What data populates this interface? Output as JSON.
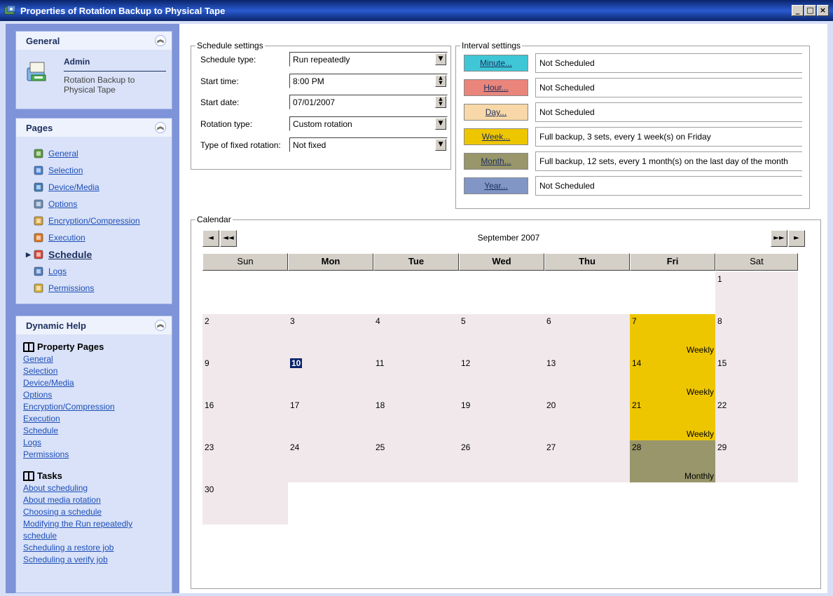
{
  "window": {
    "title": "Properties of Rotation Backup to Physical Tape",
    "min_label": "_",
    "max_label": "□",
    "close_label": "×"
  },
  "sidebar": {
    "general": {
      "title": "General",
      "user": "Admin",
      "description": "Rotation Backup to Physical Tape"
    },
    "pages": {
      "title": "Pages",
      "items": [
        {
          "label": "General",
          "icon": "document-icon"
        },
        {
          "label": "Selection",
          "icon": "folder-icon"
        },
        {
          "label": "Device/Media",
          "icon": "device-icon"
        },
        {
          "label": "Options",
          "icon": "options-icon"
        },
        {
          "label": "Encryption/Compression",
          "icon": "key-icon"
        },
        {
          "label": "Execution",
          "icon": "execution-icon"
        },
        {
          "label": "Schedule",
          "icon": "schedule-icon"
        },
        {
          "label": "Logs",
          "icon": "logs-icon"
        },
        {
          "label": "Permissions",
          "icon": "lock-icon"
        }
      ],
      "current": "Schedule"
    },
    "help": {
      "title": "Dynamic Help",
      "property_pages_title": "Property Pages",
      "property_pages": [
        "General",
        "Selection",
        "Device/Media",
        "Options",
        "Encryption/Compression",
        "Execution",
        "Schedule",
        "Logs",
        "Permissions"
      ],
      "tasks_title": "Tasks",
      "tasks": [
        "About scheduling",
        "About media rotation",
        "Choosing a schedule",
        "Modifying the Run repeatedly",
        "schedule",
        "Scheduling a restore job",
        "Scheduling a verify job"
      ]
    }
  },
  "schedule_settings": {
    "legend": "Schedule settings",
    "schedule_type": {
      "label": "Schedule type:",
      "value": "Run repeatedly"
    },
    "start_time": {
      "label": "Start time:",
      "value": "8:00 PM"
    },
    "start_date": {
      "label": "Start date:",
      "value": "07/01/2007"
    },
    "rotation_type": {
      "label": "Rotation type:",
      "value": "Custom rotation"
    },
    "fixed_rotation": {
      "label": "Type of fixed rotation:",
      "value": "Not fixed"
    }
  },
  "interval_settings": {
    "legend": "Interval settings",
    "rows": [
      {
        "button": "Minute...",
        "text": "Not Scheduled",
        "color": "#3fc7d6"
      },
      {
        "button": "Hour...",
        "text": "Not Scheduled",
        "color": "#e9857a"
      },
      {
        "button": "Day...",
        "text": "Not Scheduled",
        "color": "#f8d8a8"
      },
      {
        "button": "Week...",
        "text": "Full backup, 3 sets, every 1 week(s) on Friday",
        "color": "#eec600"
      },
      {
        "button": "Month...",
        "text": "Full backup, 12 sets, every 1 month(s) on the last day of the month",
        "color": "#98966a"
      },
      {
        "button": "Year...",
        "text": "Not Scheduled",
        "color": "#8296c6"
      }
    ]
  },
  "calendar": {
    "legend": "Calendar",
    "month_title": "September 2007",
    "nav_prev": "◄",
    "nav_prev_fast": "◄◄",
    "nav_next_fast": "►►",
    "nav_next": "►",
    "day_headers": [
      "Sun",
      "Mon",
      "Tue",
      "Wed",
      "Thu",
      "Fri",
      "Sat"
    ],
    "weeks": [
      [
        null,
        null,
        null,
        null,
        null,
        null,
        {
          "d": "1"
        }
      ],
      [
        {
          "d": "2"
        },
        {
          "d": "3"
        },
        {
          "d": "4"
        },
        {
          "d": "5"
        },
        {
          "d": "6"
        },
        {
          "d": "7",
          "label": "Weekly",
          "kind": "week"
        },
        {
          "d": "8"
        }
      ],
      [
        {
          "d": "9"
        },
        {
          "d": "10",
          "today": true
        },
        {
          "d": "11"
        },
        {
          "d": "12"
        },
        {
          "d": "13"
        },
        {
          "d": "14",
          "label": "Weekly",
          "kind": "week"
        },
        {
          "d": "15"
        }
      ],
      [
        {
          "d": "16"
        },
        {
          "d": "17"
        },
        {
          "d": "18"
        },
        {
          "d": "19"
        },
        {
          "d": "20"
        },
        {
          "d": "21",
          "label": "Weekly",
          "kind": "week"
        },
        {
          "d": "22"
        }
      ],
      [
        {
          "d": "23"
        },
        {
          "d": "24"
        },
        {
          "d": "25"
        },
        {
          "d": "26"
        },
        {
          "d": "27"
        },
        {
          "d": "28",
          "label": "Monthly",
          "kind": "month"
        },
        {
          "d": "29"
        }
      ],
      [
        {
          "d": "30"
        },
        null,
        null,
        null,
        null,
        null,
        null
      ]
    ],
    "colors": {
      "day_bg": "#f0e8ea",
      "week": "#eec600",
      "month": "#98966a"
    }
  }
}
